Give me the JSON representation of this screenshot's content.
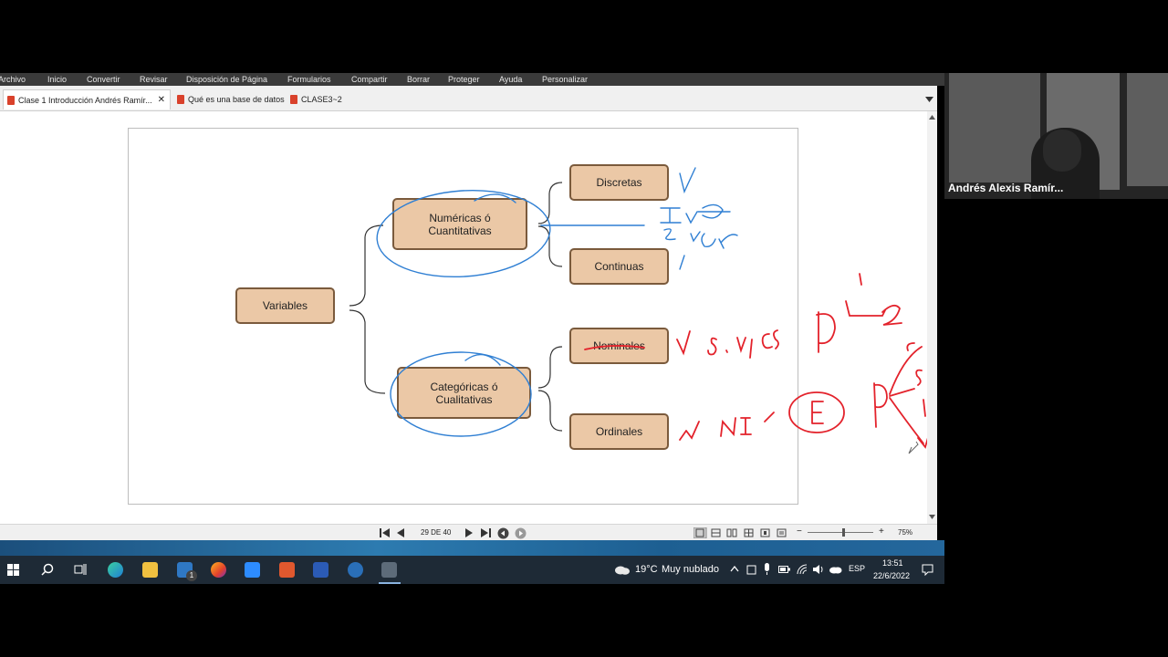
{
  "menu": [
    "Archivo",
    "Inicio",
    "Convertir",
    "Revisar",
    "Disposición de Página",
    "Formularios",
    "Compartir",
    "Borrar",
    "Proteger",
    "Ayuda",
    "Personalizar"
  ],
  "tabs": [
    {
      "label": "Clase 1 Introducción Andrés Ramír...",
      "active": true
    },
    {
      "label": "Qué es una base de datos",
      "active": false
    },
    {
      "label": "CLASE3~2",
      "active": false
    }
  ],
  "tab_close": "✕",
  "diagram": {
    "root": "Variables",
    "numeric": {
      "line1": "Numéricas ó",
      "line2": "Cuantitativas"
    },
    "categorical": {
      "line1": "Categóricas ó",
      "line2": "Cualitativas"
    },
    "leaves": [
      "Discretas",
      "Continuas",
      "Nominales",
      "Ordinales"
    ]
  },
  "navigation": {
    "page_indicator": "29 DE 40",
    "zoom": "75%",
    "zoom_level": 0.75
  },
  "taskbar": {
    "temperature": "19°C",
    "weather": "Muy nublado",
    "language": "ESP",
    "time": "13:51",
    "date": "22/6/2022",
    "mail_badge": "1"
  },
  "webcam": {
    "participant_name": "Andrés Alexis Ramír..."
  },
  "colors": {
    "box_fill": "#ebc8a6",
    "box_border": "#7a5a3c",
    "ink_blue": "#2f7fd3",
    "ink_red": "#e3222b"
  }
}
